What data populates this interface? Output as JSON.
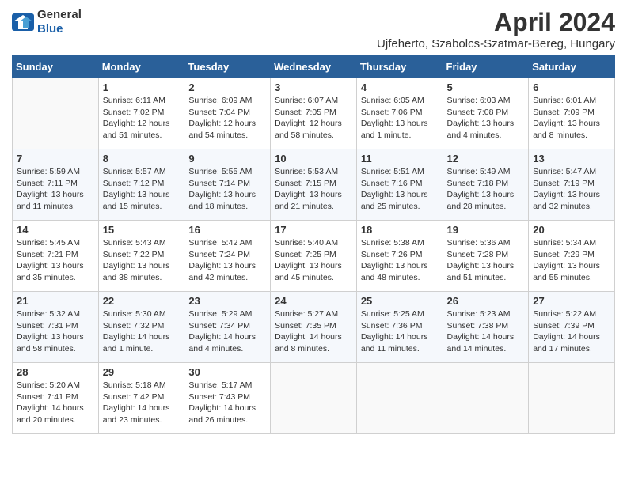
{
  "logo": {
    "general": "General",
    "blue": "Blue"
  },
  "header": {
    "month": "April 2024",
    "location": "Ujfeherto, Szabolcs-Szatmar-Bereg, Hungary"
  },
  "columns": [
    "Sunday",
    "Monday",
    "Tuesday",
    "Wednesday",
    "Thursday",
    "Friday",
    "Saturday"
  ],
  "weeks": [
    [
      {
        "day": "",
        "info": ""
      },
      {
        "day": "1",
        "info": "Sunrise: 6:11 AM\nSunset: 7:02 PM\nDaylight: 12 hours\nand 51 minutes."
      },
      {
        "day": "2",
        "info": "Sunrise: 6:09 AM\nSunset: 7:04 PM\nDaylight: 12 hours\nand 54 minutes."
      },
      {
        "day": "3",
        "info": "Sunrise: 6:07 AM\nSunset: 7:05 PM\nDaylight: 12 hours\nand 58 minutes."
      },
      {
        "day": "4",
        "info": "Sunrise: 6:05 AM\nSunset: 7:06 PM\nDaylight: 13 hours\nand 1 minute."
      },
      {
        "day": "5",
        "info": "Sunrise: 6:03 AM\nSunset: 7:08 PM\nDaylight: 13 hours\nand 4 minutes."
      },
      {
        "day": "6",
        "info": "Sunrise: 6:01 AM\nSunset: 7:09 PM\nDaylight: 13 hours\nand 8 minutes."
      }
    ],
    [
      {
        "day": "7",
        "info": "Sunrise: 5:59 AM\nSunset: 7:11 PM\nDaylight: 13 hours\nand 11 minutes."
      },
      {
        "day": "8",
        "info": "Sunrise: 5:57 AM\nSunset: 7:12 PM\nDaylight: 13 hours\nand 15 minutes."
      },
      {
        "day": "9",
        "info": "Sunrise: 5:55 AM\nSunset: 7:14 PM\nDaylight: 13 hours\nand 18 minutes."
      },
      {
        "day": "10",
        "info": "Sunrise: 5:53 AM\nSunset: 7:15 PM\nDaylight: 13 hours\nand 21 minutes."
      },
      {
        "day": "11",
        "info": "Sunrise: 5:51 AM\nSunset: 7:16 PM\nDaylight: 13 hours\nand 25 minutes."
      },
      {
        "day": "12",
        "info": "Sunrise: 5:49 AM\nSunset: 7:18 PM\nDaylight: 13 hours\nand 28 minutes."
      },
      {
        "day": "13",
        "info": "Sunrise: 5:47 AM\nSunset: 7:19 PM\nDaylight: 13 hours\nand 32 minutes."
      }
    ],
    [
      {
        "day": "14",
        "info": "Sunrise: 5:45 AM\nSunset: 7:21 PM\nDaylight: 13 hours\nand 35 minutes."
      },
      {
        "day": "15",
        "info": "Sunrise: 5:43 AM\nSunset: 7:22 PM\nDaylight: 13 hours\nand 38 minutes."
      },
      {
        "day": "16",
        "info": "Sunrise: 5:42 AM\nSunset: 7:24 PM\nDaylight: 13 hours\nand 42 minutes."
      },
      {
        "day": "17",
        "info": "Sunrise: 5:40 AM\nSunset: 7:25 PM\nDaylight: 13 hours\nand 45 minutes."
      },
      {
        "day": "18",
        "info": "Sunrise: 5:38 AM\nSunset: 7:26 PM\nDaylight: 13 hours\nand 48 minutes."
      },
      {
        "day": "19",
        "info": "Sunrise: 5:36 AM\nSunset: 7:28 PM\nDaylight: 13 hours\nand 51 minutes."
      },
      {
        "day": "20",
        "info": "Sunrise: 5:34 AM\nSunset: 7:29 PM\nDaylight: 13 hours\nand 55 minutes."
      }
    ],
    [
      {
        "day": "21",
        "info": "Sunrise: 5:32 AM\nSunset: 7:31 PM\nDaylight: 13 hours\nand 58 minutes."
      },
      {
        "day": "22",
        "info": "Sunrise: 5:30 AM\nSunset: 7:32 PM\nDaylight: 14 hours\nand 1 minute."
      },
      {
        "day": "23",
        "info": "Sunrise: 5:29 AM\nSunset: 7:34 PM\nDaylight: 14 hours\nand 4 minutes."
      },
      {
        "day": "24",
        "info": "Sunrise: 5:27 AM\nSunset: 7:35 PM\nDaylight: 14 hours\nand 8 minutes."
      },
      {
        "day": "25",
        "info": "Sunrise: 5:25 AM\nSunset: 7:36 PM\nDaylight: 14 hours\nand 11 minutes."
      },
      {
        "day": "26",
        "info": "Sunrise: 5:23 AM\nSunset: 7:38 PM\nDaylight: 14 hours\nand 14 minutes."
      },
      {
        "day": "27",
        "info": "Sunrise: 5:22 AM\nSunset: 7:39 PM\nDaylight: 14 hours\nand 17 minutes."
      }
    ],
    [
      {
        "day": "28",
        "info": "Sunrise: 5:20 AM\nSunset: 7:41 PM\nDaylight: 14 hours\nand 20 minutes."
      },
      {
        "day": "29",
        "info": "Sunrise: 5:18 AM\nSunset: 7:42 PM\nDaylight: 14 hours\nand 23 minutes."
      },
      {
        "day": "30",
        "info": "Sunrise: 5:17 AM\nSunset: 7:43 PM\nDaylight: 14 hours\nand 26 minutes."
      },
      {
        "day": "",
        "info": ""
      },
      {
        "day": "",
        "info": ""
      },
      {
        "day": "",
        "info": ""
      },
      {
        "day": "",
        "info": ""
      }
    ]
  ]
}
